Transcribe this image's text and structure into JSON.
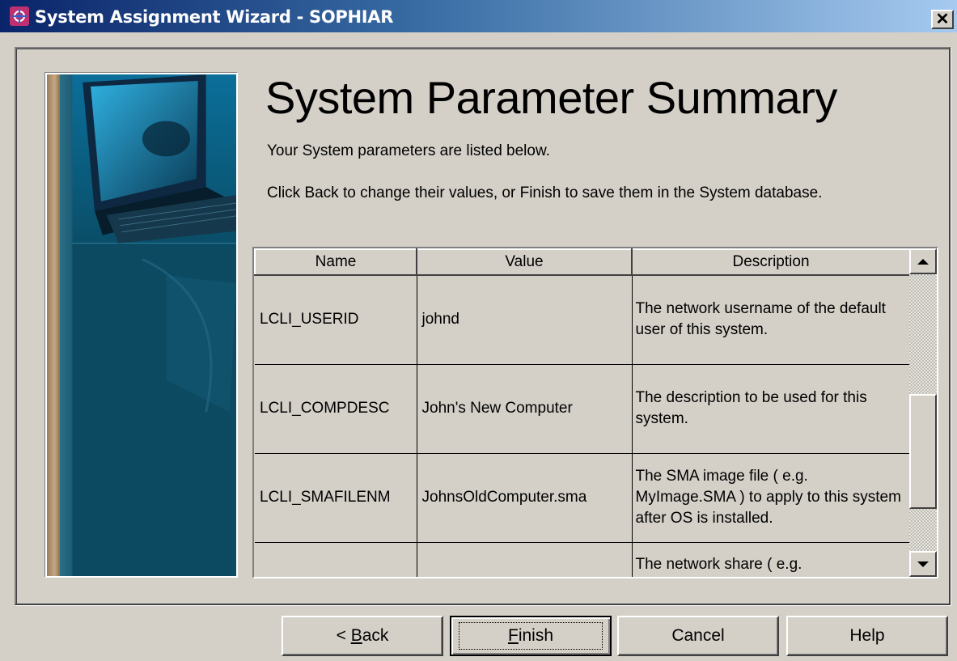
{
  "window": {
    "title": "System Assignment Wizard - SOPHIAR",
    "close_label": "✕"
  },
  "page": {
    "heading": "System Parameter Summary",
    "intro_line1": "Your System parameters are listed below.",
    "intro_line2": "Click Back to change their values, or Finish to save them in the System database."
  },
  "grid": {
    "columns": [
      "Name",
      "Value",
      "Description"
    ],
    "rows": [
      {
        "name": "LCLI_USERID",
        "value": "johnd",
        "description": " The network username of the default user of this system."
      },
      {
        "name": "LCLI_COMPDESC",
        "value": "John's New Computer",
        "description": " The description to be used for this system."
      },
      {
        "name": "LCLI_SMAFILENM",
        "value": "JohnsOldComputer.sma",
        "description": " The SMA image file ( e.g. MyImage.SMA )  to apply to this system after OS is installed."
      },
      {
        "name": "",
        "value": "",
        "description": " The network share ( e.g."
      }
    ]
  },
  "buttons": {
    "back_prefix": "< ",
    "back_mnemonic": "B",
    "back_rest": "ack",
    "finish_mnemonic": "F",
    "finish_rest": "inish",
    "cancel": "Cancel",
    "help": "Help"
  },
  "icons": {
    "app": "wizard-app-icon",
    "close": "close-icon",
    "scroll_up": "scroll-up-arrow-icon",
    "scroll_down": "scroll-down-arrow-icon"
  }
}
